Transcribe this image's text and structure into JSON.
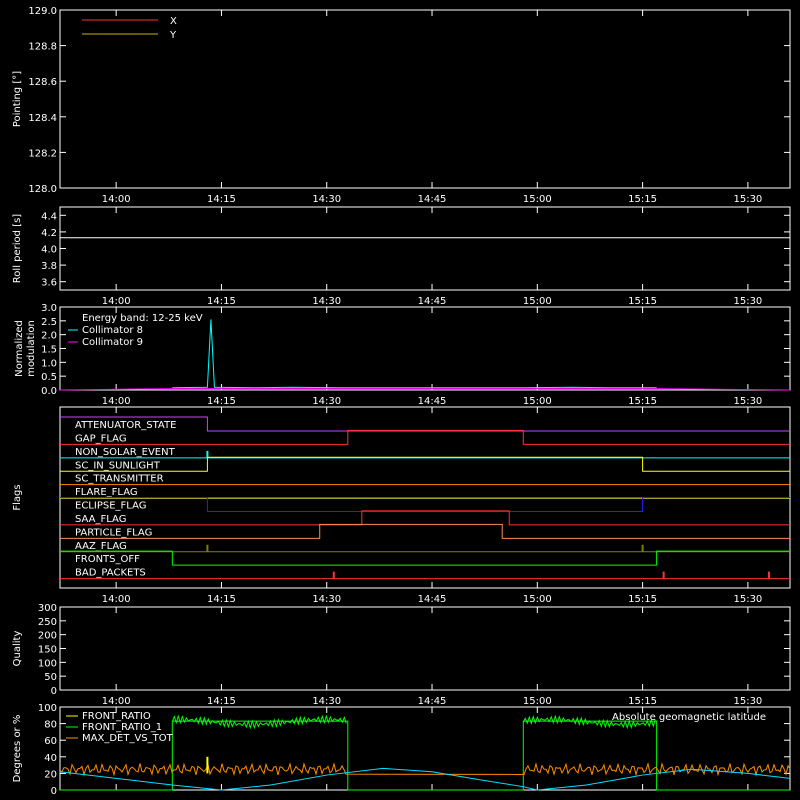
{
  "chart_data": [
    {
      "type": "line",
      "ylabel": "Pointing [°]",
      "ylim": [
        128.0,
        129.0
      ],
      "yticks": [
        "128.0",
        "128.2",
        "128.4",
        "128.6",
        "128.8",
        "129.0"
      ],
      "xticks": [
        "14:00",
        "14:15",
        "14:30",
        "14:45",
        "15:00",
        "15:15",
        "15:30"
      ],
      "legend_position": "top-left",
      "series": [
        {
          "name": "X",
          "color": "#ff3030",
          "x": [],
          "y": []
        },
        {
          "name": "Y",
          "color": "#c8b400",
          "x": [],
          "y": []
        }
      ]
    },
    {
      "type": "line",
      "ylabel": "Roll period [s]",
      "ylim": [
        3.5,
        4.5
      ],
      "yticks": [
        "3.6",
        "3.8",
        "4.0",
        "4.2",
        "4.4"
      ],
      "xticks": [
        "14:00",
        "14:15",
        "14:30",
        "14:45",
        "15:00",
        "15:15",
        "15:30"
      ],
      "series": [
        {
          "name": "",
          "color": "#ffffff",
          "x": [
            "13:52",
            "14:00",
            "14:10",
            "14:20",
            "14:30",
            "14:40",
            "14:50",
            "15:00",
            "15:10",
            "15:20",
            "15:30",
            "15:36"
          ],
          "y": [
            4.13,
            4.13,
            4.13,
            4.13,
            4.13,
            4.13,
            4.13,
            4.13,
            4.13,
            4.13,
            4.13,
            4.13
          ]
        }
      ]
    },
    {
      "type": "line",
      "ylabel": "Normalized modulation",
      "ylim": [
        0.0,
        3.0
      ],
      "yticks": [
        "0.0",
        "0.5",
        "1.0",
        "1.5",
        "2.0",
        "2.5",
        "3.0"
      ],
      "xticks": [
        "14:00",
        "14:15",
        "14:30",
        "14:45",
        "15:00",
        "15:15",
        "15:30"
      ],
      "annotation": "Energy band: 12-25 keV",
      "legend_position": "top-left",
      "series": [
        {
          "name": "Collimator 8",
          "color": "#00ffff",
          "x": [
            "14:08",
            "14:13",
            "14:13:30",
            "14:14",
            "14:20",
            "14:25",
            "14:32",
            "14:58",
            "15:05",
            "15:10",
            "15:17"
          ],
          "y": [
            0.08,
            0.1,
            2.55,
            0.1,
            0.08,
            0.1,
            0.08,
            0.08,
            0.1,
            0.08,
            0.08
          ]
        },
        {
          "name": "Collimator 9",
          "color": "#ff00ff",
          "x": [
            "13:52",
            "14:08",
            "14:20",
            "14:32",
            "14:58",
            "15:10",
            "15:17",
            "15:36"
          ],
          "y": [
            0.0,
            0.05,
            0.05,
            0.05,
            0.05,
            0.05,
            0.05,
            0.0
          ]
        }
      ]
    },
    {
      "type": "line",
      "ylabel": "Flags",
      "xticks": [
        "14:00",
        "14:15",
        "14:30",
        "14:45",
        "15:00",
        "15:15",
        "15:30"
      ],
      "flags": [
        {
          "name": "ATTENUATOR_STATE",
          "color": "#cc44ff",
          "segments": [
            [
              "13:52",
              1
            ],
            [
              "14:13",
              0
            ],
            [
              "15:36",
              0
            ]
          ]
        },
        {
          "name": "GAP_FLAG",
          "color": "#ff3030",
          "segments": [
            [
              "13:52",
              0
            ],
            [
              "14:33",
              1
            ],
            [
              "14:58",
              0
            ],
            [
              "15:36",
              0
            ]
          ]
        },
        {
          "name": "NON_SOLAR_EVENT",
          "color": "#00ffff",
          "segments": [
            [
              "13:52",
              0
            ],
            [
              "15:36",
              0
            ]
          ],
          "spikes": [
            "14:13"
          ]
        },
        {
          "name": "SC_IN_SUNLIGHT",
          "color": "#ffff00",
          "segments": [
            [
              "13:52",
              0
            ],
            [
              "14:13",
              1
            ],
            [
              "15:15",
              0
            ],
            [
              "15:36",
              0
            ]
          ]
        },
        {
          "name": "SC_TRANSMITTER",
          "color": "#ff8c00",
          "segments": [
            [
              "13:52",
              0
            ],
            [
              "15:36",
              0
            ]
          ]
        },
        {
          "name": "FLARE_FLAG",
          "color": "#ffff40",
          "segments": [
            [
              "13:52",
              0
            ],
            [
              "15:36",
              0
            ]
          ]
        },
        {
          "name": "ECLIPSE_FLAG",
          "color": "#2020ff",
          "segments": [
            [
              "13:52",
              1
            ],
            [
              "14:13",
              0
            ],
            [
              "15:15",
              1
            ],
            [
              "15:36",
              1
            ]
          ]
        },
        {
          "name": "SAA_FLAG",
          "color": "#ff3030",
          "segments": [
            [
              "13:52",
              0
            ],
            [
              "14:35",
              1
            ],
            [
              "14:56",
              0
            ],
            [
              "15:36",
              0
            ]
          ]
        },
        {
          "name": "PARTICLE_FLAG",
          "color": "#ff8c50",
          "segments": [
            [
              "13:52",
              0
            ],
            [
              "14:29",
              1
            ],
            [
              "14:55",
              0
            ],
            [
              "15:36",
              0
            ]
          ]
        },
        {
          "name": "AAZ_FLAG",
          "color": "#808000",
          "segments": [
            [
              "13:52",
              0
            ],
            [
              "15:36",
              0
            ]
          ],
          "spikes": [
            "14:13",
            "15:15"
          ]
        },
        {
          "name": "FRONTS_OFF",
          "color": "#00ff00",
          "segments": [
            [
              "13:52",
              1
            ],
            [
              "14:08",
              0
            ],
            [
              "15:17",
              1
            ],
            [
              "15:36",
              1
            ]
          ]
        },
        {
          "name": "BAD_PACKETS",
          "color": "#ff3030",
          "segments": [
            [
              "13:52",
              0
            ],
            [
              "15:36",
              0
            ]
          ],
          "spikes": [
            "14:31",
            "15:18",
            "15:33"
          ]
        }
      ]
    },
    {
      "type": "line",
      "ylabel": "Quality",
      "ylim": [
        0,
        300
      ],
      "yticks": [
        "0",
        "50",
        "100",
        "150",
        "200",
        "250",
        "300"
      ],
      "xticks": [
        "14:00",
        "14:15",
        "14:30",
        "14:45",
        "15:00",
        "15:15",
        "15:30"
      ],
      "series": []
    },
    {
      "type": "line",
      "ylabel": "Degrees or %",
      "ylim": [
        0,
        100
      ],
      "yticks": [
        "0",
        "20",
        "40",
        "60",
        "80",
        "100"
      ],
      "xticks": [
        "14:00",
        "14:15",
        "14:30",
        "14:45",
        "15:00",
        "15:15",
        "15:30"
      ],
      "legend_position": "top-left",
      "series": [
        {
          "name": "FRONT_RATIO",
          "color": "#ffff00",
          "values_note": ""
        },
        {
          "name": "FRONT_RATIO_1",
          "color": "#00ff00"
        },
        {
          "name": "MAX_DET_VS_TOT",
          "color": "#ff8c00"
        },
        {
          "name": "Absolute geomagnetic latitude",
          "color": "#00e0ff"
        }
      ],
      "green_segments": [
        [
          "13:52",
          0
        ],
        [
          "14:08",
          0
        ],
        [
          "14:08",
          83
        ],
        [
          "14:33",
          83
        ],
        [
          "14:33",
          0
        ],
        [
          "14:58",
          0
        ],
        [
          "14:58",
          83
        ],
        [
          "15:17",
          83
        ],
        [
          "15:17",
          0
        ],
        [
          "15:36",
          0
        ]
      ],
      "orange_level": 25,
      "cyan_points": [
        [
          "13:52",
          22
        ],
        [
          "14:00",
          14
        ],
        [
          "14:08",
          6
        ],
        [
          "14:15",
          0
        ],
        [
          "14:22",
          6
        ],
        [
          "14:30",
          18
        ],
        [
          "14:38",
          26
        ],
        [
          "14:45",
          22
        ],
        [
          "14:52",
          12
        ],
        [
          "14:58",
          4
        ],
        [
          "15:00",
          0
        ],
        [
          "15:07",
          6
        ],
        [
          "15:15",
          18
        ],
        [
          "15:22",
          25
        ],
        [
          "15:30",
          20
        ],
        [
          "15:36",
          14
        ]
      ]
    }
  ]
}
